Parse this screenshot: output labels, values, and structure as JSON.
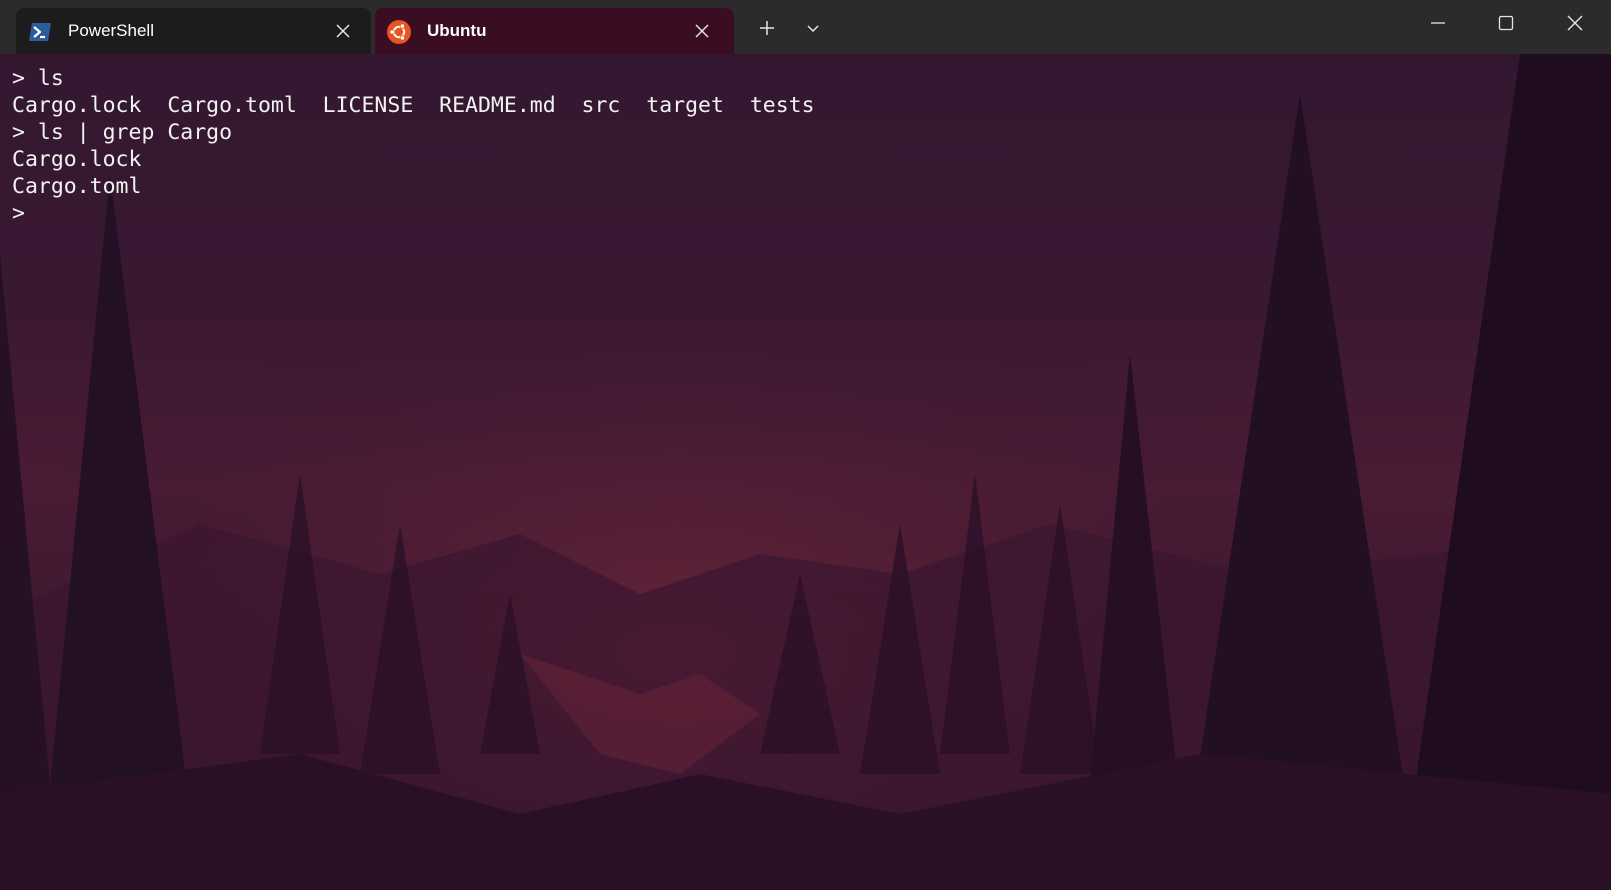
{
  "tabs": [
    {
      "label": "PowerShell",
      "icon": "powershell-icon",
      "active": false
    },
    {
      "label": "Ubuntu",
      "icon": "ubuntu-icon",
      "active": true
    }
  ],
  "titlebar": {
    "new_tab_icon": "plus-icon",
    "dropdown_icon": "chevron-down-icon"
  },
  "window_controls": {
    "minimize_icon": "minimize-icon",
    "maximize_icon": "maximize-icon",
    "close_icon": "close-icon"
  },
  "terminal": {
    "lines": [
      "> ls",
      "Cargo.lock  Cargo.toml  LICENSE  README.md  src  target  tests",
      "> ls | grep Cargo",
      "Cargo.lock",
      "Cargo.toml",
      ">"
    ]
  },
  "colors": {
    "titlebar_bg": "#2b2b2b",
    "active_tab_bg": "#3a0d22",
    "inactive_tab_bg": "#1c1c1c",
    "terminal_text": "#f2f2f2",
    "ubuntu_orange": "#e95420",
    "powershell_blue": "#2d5c9c"
  }
}
